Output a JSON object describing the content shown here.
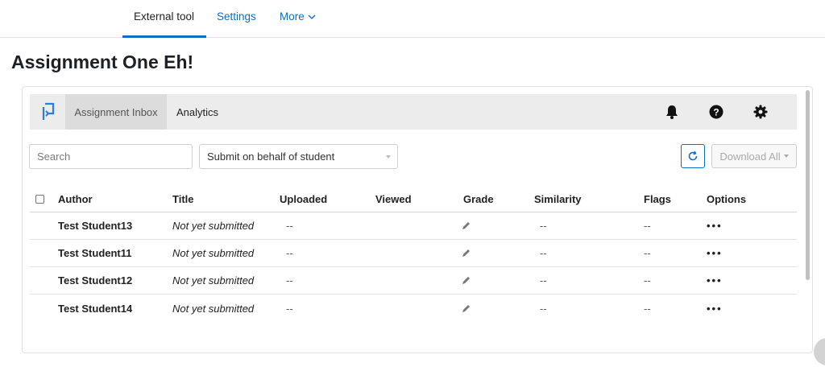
{
  "nav": {
    "tabs": [
      {
        "label": "External tool",
        "active": true
      },
      {
        "label": "Settings",
        "active": false
      },
      {
        "label": "More",
        "active": false
      }
    ]
  },
  "page": {
    "title": "Assignment One Eh!"
  },
  "tool": {
    "nav": {
      "inbox_label": "Assignment Inbox",
      "analytics_label": "Analytics"
    },
    "icons": [
      "logo-icon",
      "bell-icon",
      "help-icon",
      "gear-icon"
    ],
    "search": {
      "placeholder": "Search",
      "value": ""
    },
    "submit_select": {
      "value": "Submit on behalf of student"
    },
    "download_label": "Download All",
    "accent_color": "#0f6cbf"
  },
  "table": {
    "columns": [
      "Author",
      "Title",
      "Uploaded",
      "Viewed",
      "Grade",
      "Similarity",
      "Flags",
      "Options"
    ],
    "rows": [
      {
        "author": "Test Student13",
        "title": "Not yet submitted",
        "uploaded": "--",
        "viewed": "",
        "similarity": "--",
        "flags": "--"
      },
      {
        "author": "Test Student11",
        "title": "Not yet submitted",
        "uploaded": "--",
        "viewed": "",
        "similarity": "--",
        "flags": "--"
      },
      {
        "author": "Test Student12",
        "title": "Not yet submitted",
        "uploaded": "--",
        "viewed": "",
        "similarity": "--",
        "flags": "--"
      },
      {
        "author": "Test Student14",
        "title": "Not yet submitted",
        "uploaded": "--",
        "viewed": "",
        "similarity": "--",
        "flags": "--"
      }
    ],
    "options_glyph": "•••"
  }
}
